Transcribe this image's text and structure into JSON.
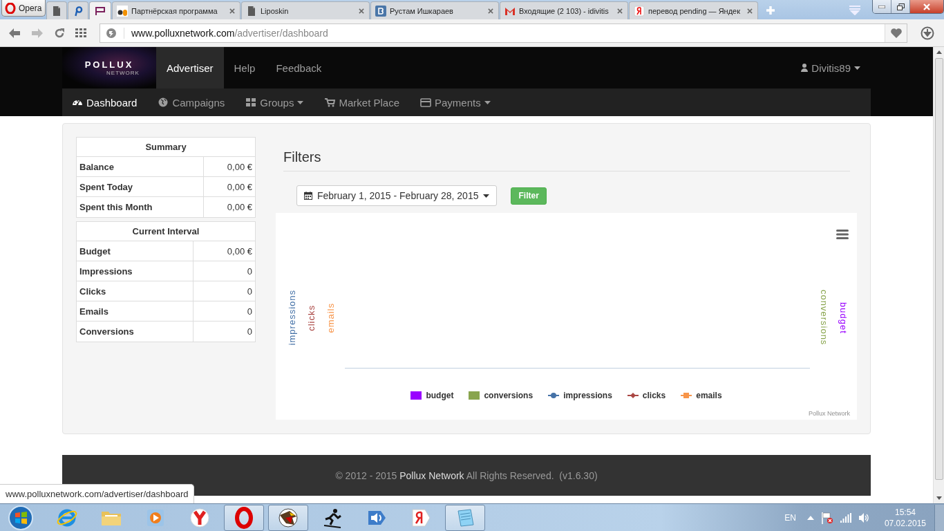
{
  "browser": {
    "menu_button": "Opera",
    "tabs": [
      {
        "kind": "page",
        "selected": false
      },
      {
        "kind": "rho",
        "selected": false
      },
      {
        "kind": "pollux",
        "selected": true
      },
      {
        "kind": "ap",
        "title": "Партнёрская программа",
        "selected": false
      },
      {
        "kind": "page",
        "title": "Liposkin",
        "selected": false
      },
      {
        "kind": "vk",
        "title": "Рустам Ишкараев",
        "selected": false
      },
      {
        "kind": "gmail",
        "title": "Входящие (2 103) - idivitis",
        "selected": false
      },
      {
        "kind": "yandex",
        "title": "перевод pending — Яндек",
        "selected": false
      }
    ],
    "address": {
      "host": "www.polluxnetwork.com",
      "path": "/advertiser/dashboard"
    }
  },
  "navbar": {
    "brand": "POLLUX",
    "brand_sub": "NETWORK",
    "items": [
      {
        "label": "Advertiser",
        "selected": true
      },
      {
        "label": "Help",
        "selected": false
      },
      {
        "label": "Feedback",
        "selected": false
      }
    ],
    "user": "Divitis89"
  },
  "subnav": [
    {
      "label": "Dashboard",
      "kind": "dashboard",
      "dropdown": false,
      "selected": true
    },
    {
      "label": "Campaigns",
      "kind": "globe",
      "dropdown": false,
      "selected": false
    },
    {
      "label": "Groups",
      "kind": "grid",
      "dropdown": true,
      "selected": false
    },
    {
      "label": "Market Place",
      "kind": "cart",
      "dropdown": false,
      "selected": false
    },
    {
      "label": "Payments",
      "kind": "card",
      "dropdown": true,
      "selected": false
    }
  ],
  "summary": {
    "title": "Summary",
    "rows": [
      {
        "label": "Balance",
        "value": "0,00 €"
      },
      {
        "label": "Spent Today",
        "value": "0,00 €"
      },
      {
        "label": "Spent this Month",
        "value": "0,00 €"
      }
    ]
  },
  "interval": {
    "title": "Current Interval",
    "rows": [
      {
        "label": "Budget",
        "value": "0,00 €"
      },
      {
        "label": "Impressions",
        "value": "0"
      },
      {
        "label": "Clicks",
        "value": "0"
      },
      {
        "label": "Emails",
        "value": "0"
      },
      {
        "label": "Conversions",
        "value": "0"
      }
    ]
  },
  "filters": {
    "title": "Filters",
    "date_range": "February 1, 2015 - February 28, 2015",
    "button": "Filter"
  },
  "chart": {
    "left_axes": [
      {
        "title": "impressions",
        "color": "#4572a7"
      },
      {
        "title": "clicks",
        "color": "#aa4643"
      },
      {
        "title": "emails",
        "color": "#f7954a"
      }
    ],
    "right_axes": [
      {
        "title": "conversions",
        "color": "#89a54e"
      },
      {
        "title": "budget",
        "color": "#9900ff"
      }
    ],
    "legend": [
      {
        "label": "budget",
        "kind": "bar",
        "color": "#9900ff"
      },
      {
        "label": "conversions",
        "kind": "bar",
        "color": "#89a54e"
      },
      {
        "label": "impressions",
        "kind": "circle",
        "color": "#4572a7"
      },
      {
        "label": "clicks",
        "kind": "diamond",
        "color": "#aa4643"
      },
      {
        "label": "emails",
        "kind": "square",
        "color": "#f7954a"
      }
    ],
    "credits": "Pollux Network"
  },
  "footer": {
    "prefix": "© 2012 - 2015",
    "link": "Pollux Network",
    "suffix": "All Rights Reserved.  (v1.6.30)"
  },
  "status_url": "www.polluxnetwork.com/advertiser/dashboard",
  "taskbar": {
    "pinned": [
      {
        "kind": "ie",
        "open": false
      },
      {
        "kind": "folder",
        "open": false
      },
      {
        "kind": "media",
        "open": false
      },
      {
        "kind": "ybrowser",
        "open": false
      },
      {
        "kind": "opera",
        "open": true
      },
      {
        "kind": "eagle",
        "open": true
      },
      {
        "kind": "skater",
        "open": false
      },
      {
        "kind": "speaker",
        "open": false
      },
      {
        "kind": "yandex",
        "open": false
      },
      {
        "kind": "notepad",
        "open": true
      }
    ],
    "language": "EN",
    "time": "15:54",
    "date": "07.02.2015"
  }
}
